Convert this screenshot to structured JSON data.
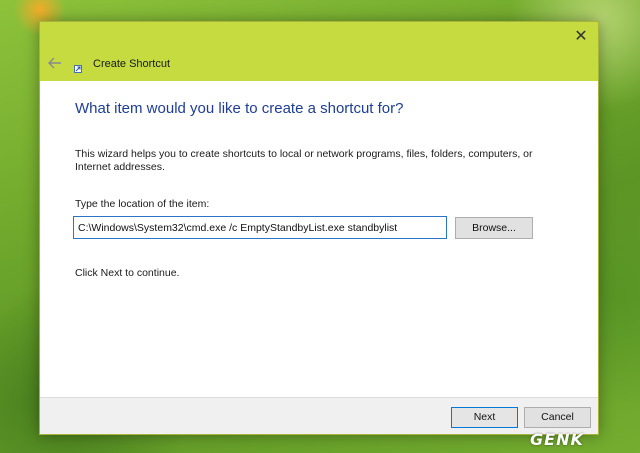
{
  "window": {
    "title": "Create Shortcut",
    "close_glyph": "✕",
    "back_icon": "back-arrow-icon",
    "wizard_icon": "shortcut-wizard-icon"
  },
  "content": {
    "heading": "What item would you like to create a shortcut for?",
    "description": "This wizard helps you to create shortcuts to local or network programs, files, folders, computers, or Internet addresses.",
    "location_label": "Type the location of the item:",
    "location_value": "C:\\Windows\\System32\\cmd.exe /c EmptyStandbyList.exe standbylist",
    "browse_label": "Browse...",
    "continue_text": "Click Next to continue."
  },
  "footer": {
    "next_label": "Next",
    "cancel_label": "Cancel"
  },
  "watermark": {
    "text": "GENK"
  },
  "colors": {
    "title_bar": "#c5db3f",
    "heading": "#1e3d96",
    "focus_border": "#2b75c9",
    "default_button_border": "#0078d7"
  }
}
